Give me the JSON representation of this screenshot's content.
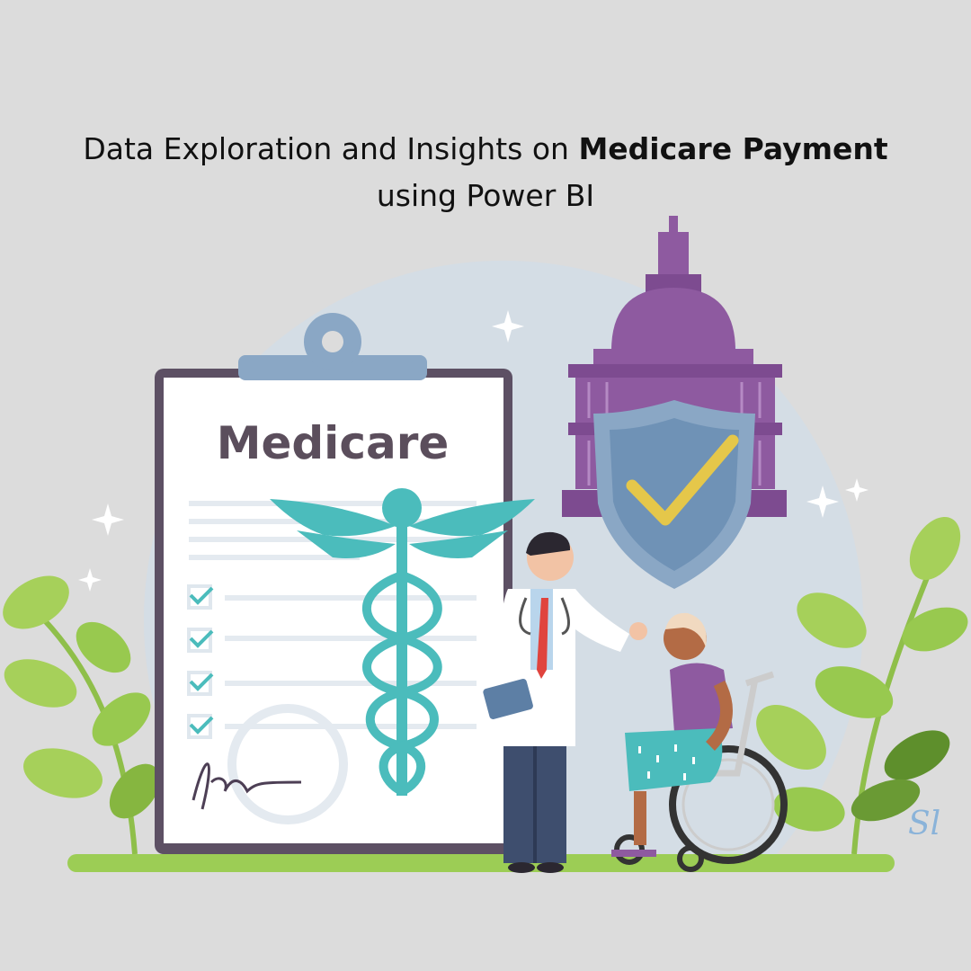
{
  "title": {
    "line1_prefix": "Data Exploration and Insights on ",
    "line1_bold": "Medicare Payment",
    "line2": "using Power BI"
  },
  "clipboard": {
    "heading": "Medicare",
    "checked_items": 4
  },
  "watermark": "Sl",
  "colors": {
    "background": "#dcdcdc",
    "circle": "#d4dde5",
    "capitol": "#8e5aa0",
    "shield": "#6f92b6",
    "check": "#e5c74a",
    "caduceus": "#4bbcbc",
    "leaves": "#98c94f"
  }
}
